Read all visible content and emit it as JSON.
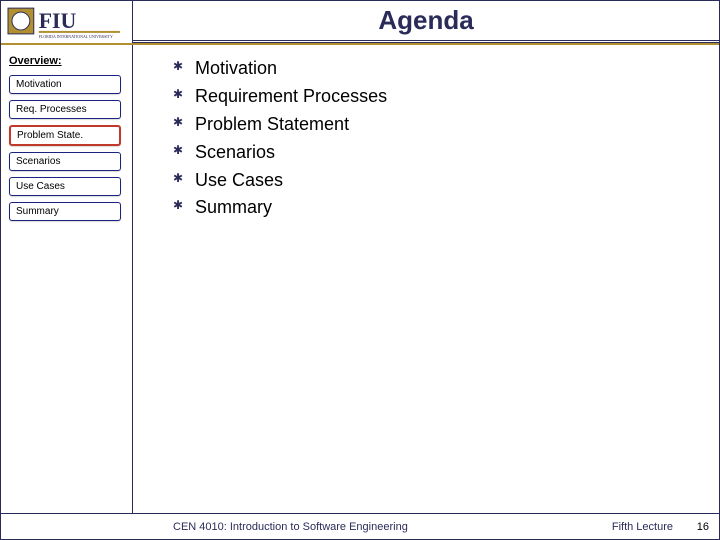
{
  "header": {
    "title": "Agenda"
  },
  "sidebar": {
    "title": "Overview:",
    "items": [
      {
        "label": "Motivation",
        "active": false
      },
      {
        "label": "Req. Processes",
        "active": false
      },
      {
        "label": "Problem State.",
        "active": true
      },
      {
        "label": "Scenarios",
        "active": false
      },
      {
        "label": "Use Cases",
        "active": false
      },
      {
        "label": "Summary",
        "active": false
      }
    ]
  },
  "agenda": [
    "Motivation",
    "Requirement Processes",
    "Problem Statement",
    "Scenarios",
    "Use Cases",
    "Summary"
  ],
  "footer": {
    "course": "CEN 4010: Introduction to Software Engineering",
    "lecture": "Fifth Lecture",
    "page": "16"
  }
}
